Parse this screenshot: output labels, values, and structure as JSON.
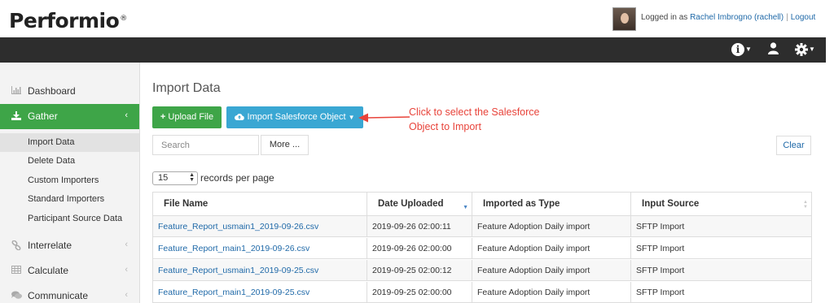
{
  "header": {
    "logo_text": "Performio",
    "logo_mark": "®",
    "login_prefix": "Logged in as",
    "user_name": "Rachel Imbrogno (rachell)",
    "separator": "|",
    "logout_label": "Logout"
  },
  "navbar": {
    "info_icon": "info-circle",
    "user_icon": "user",
    "settings_icon": "gear"
  },
  "sidebar": {
    "items": [
      {
        "label": "Dashboard",
        "icon": "bar-chart"
      },
      {
        "label": "Gather",
        "icon": "download",
        "active": true
      },
      {
        "label": "Interrelate",
        "icon": "link"
      },
      {
        "label": "Calculate",
        "icon": "table"
      },
      {
        "label": "Communicate",
        "icon": "comments"
      }
    ],
    "gather_sub": [
      {
        "label": "Import Data",
        "current": true
      },
      {
        "label": "Delete Data"
      },
      {
        "label": "Custom Importers"
      },
      {
        "label": "Standard Importers"
      },
      {
        "label": "Participant Source Data"
      }
    ]
  },
  "main": {
    "title": "Import Data",
    "upload_label": "Upload File",
    "import_sf_label": "Import Salesforce Object",
    "search_placeholder": "Search",
    "more_label": "More ...",
    "clear_label": "Clear",
    "records_per_page_value": "15",
    "records_per_page_label": "records per page",
    "annotation": "Click to select the Salesforce Object to Import",
    "annotation_color": "#e8433a"
  },
  "table": {
    "columns": [
      "File Name",
      "Date Uploaded",
      "Imported as Type",
      "Input Source"
    ],
    "rows": [
      [
        "Feature_Report_usmain1_2019-09-26.csv",
        "2019-09-26 02:00:11",
        "Feature Adoption Daily import",
        "SFTP Import"
      ],
      [
        "Feature_Report_main1_2019-09-26.csv",
        "2019-09-26 02:00:00",
        "Feature Adoption Daily import",
        "SFTP Import"
      ],
      [
        "Feature_Report_usmain1_2019-09-25.csv",
        "2019-09-25 02:00:12",
        "Feature Adoption Daily import",
        "SFTP Import"
      ],
      [
        "Feature_Report_main1_2019-09-25.csv",
        "2019-09-25 02:00:00",
        "Feature Adoption Daily import",
        "SFTP Import"
      ]
    ]
  },
  "colors": {
    "accent_green": "#3ea548",
    "accent_blue": "#3aa7d3",
    "navbar": "#2d2d2d",
    "link": "#1f69a8"
  }
}
